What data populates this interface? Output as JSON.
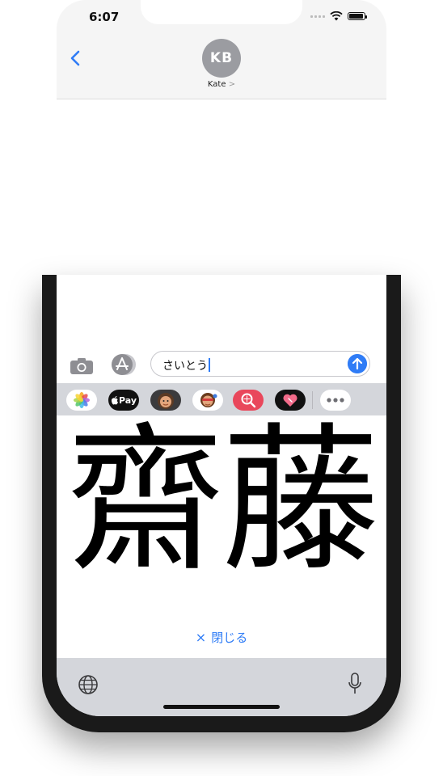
{
  "status_bar": {
    "time": "6:07"
  },
  "header": {
    "avatar_initials": "KB",
    "contact_name": "Kate",
    "contact_chevron": ">"
  },
  "compose": {
    "text": "さいとう"
  },
  "app_drawer": {
    "apple_pay_label": "Pay"
  },
  "candidate": {
    "kanji": "齋藤"
  },
  "close_button": {
    "icon": "×",
    "label": "閉じる"
  },
  "colors": {
    "accent": "#2f7cf6",
    "avatar_bg": "#9b9ca1",
    "keyboard_bg": "#d4d6db"
  }
}
